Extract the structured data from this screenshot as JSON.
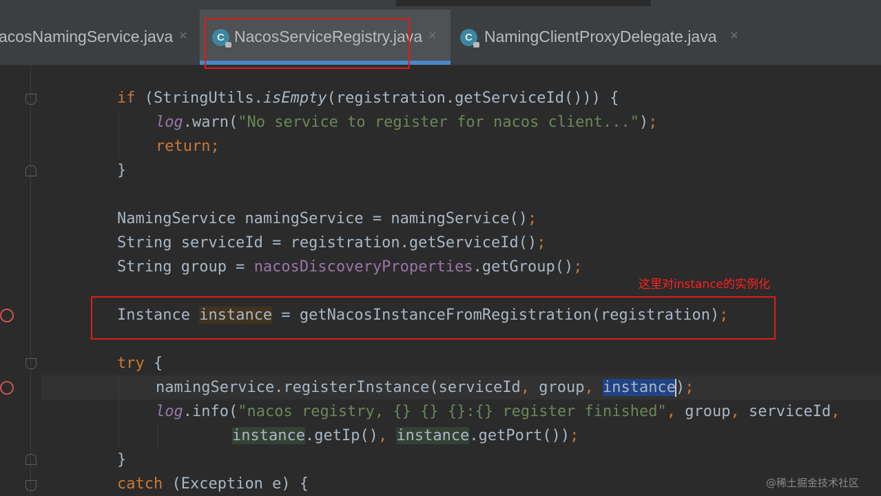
{
  "tabs": [
    {
      "label": "acosNamingService.java",
      "close": "×",
      "active": false
    },
    {
      "label": "NacosServiceRegistry.java",
      "close": "×",
      "active": true,
      "icon": "class-icon"
    },
    {
      "label": "NamingClientProxyDelegate.java",
      "close": "×",
      "active": false,
      "icon": "class-icon"
    }
  ],
  "icons": {
    "class_icon_letter": "C"
  },
  "code": {
    "l1": {
      "kw_if": "if",
      "p1": " (StringUtils.",
      "method": "isEmpty",
      "p2": "(registration.getServiceId())) {"
    },
    "l2": {
      "log": "log",
      "p1": ".warn(",
      "str": "\"No service to register for nacos client...\"",
      "p2": ")",
      "semi": ";"
    },
    "l3": {
      "kw": "return;"
    },
    "l4": {
      "p": "}"
    },
    "l5": {
      "p1": "NamingService namingService = namingService()",
      "semi": ";"
    },
    "l6": {
      "p1": "String serviceId = registration.getServiceId()",
      "semi": ";"
    },
    "l7": {
      "p1": "String group = ",
      "field": "nacosDiscoveryProperties",
      "p2": ".getGroup()",
      "semi": ";"
    },
    "l8": {
      "p1": "Instance ",
      "var": "instance",
      "p2": " = getNacosInstanceFromRegistration(registration)",
      "semi": ";"
    },
    "l9": {
      "kw": "try",
      "p": " {"
    },
    "l10": {
      "p1": "namingService.registerInstance(serviceId",
      "c1": ",",
      "p2": " group",
      "c2": ",",
      "sp": " ",
      "sel": "instance",
      "p3": ")",
      "semi": ";"
    },
    "l11": {
      "log": "log",
      "p1": ".info(",
      "str": "\"nacos registry, {} {} {}:{} register finished\"",
      "c1": ",",
      "p2": " group",
      "c2": ",",
      "p3": " serviceId",
      "c3": ","
    },
    "l12": {
      "v1": "instance",
      "p1": ".getIp()",
      "c1": ",",
      "sp": " ",
      "v2": "instance",
      "p2": ".getPort())",
      "semi": ";"
    },
    "l13": {
      "p": "}"
    },
    "l14": {
      "kw": "catch",
      "p": " (Exception e) {"
    }
  },
  "annotation": {
    "note": "这里对instance的实例化"
  },
  "watermark": "@稀土掘金技术社区",
  "colors": {
    "keyword": "#cc7832",
    "string": "#6a8759",
    "field": "#9876aa",
    "text": "#a9b7c6",
    "annotation": "#e01b1b"
  }
}
